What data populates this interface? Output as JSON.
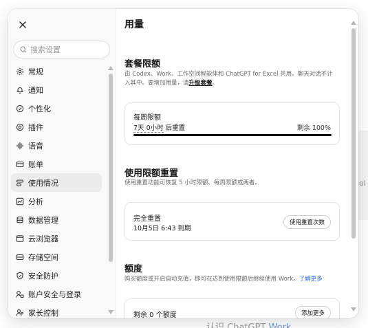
{
  "background": {
    "right_text": "ol",
    "bottom_text_prefix": "认识 ChatGPT",
    "bottom_text_accent": "Work"
  },
  "colors": {
    "accent_link": "#2f6fe0",
    "progress_fill": "#111111",
    "active_nav_bg": "#ececec"
  },
  "sidebar": {
    "close_icon": "close-icon",
    "search": {
      "placeholder": "搜索设置",
      "value": ""
    },
    "items": [
      {
        "label": "常规",
        "icon": "gear-icon"
      },
      {
        "label": "通知",
        "icon": "bell-icon"
      },
      {
        "label": "个性化",
        "icon": "personalize-icon"
      },
      {
        "label": "插件",
        "icon": "at-plugin-icon"
      },
      {
        "label": "语音",
        "icon": "voice-icon"
      },
      {
        "label": "账单",
        "icon": "card-icon"
      },
      {
        "label": "使用情况",
        "icon": "usage-icon",
        "active": true
      },
      {
        "label": "分析",
        "icon": "chart-icon"
      },
      {
        "label": "数据管理",
        "icon": "database-icon"
      },
      {
        "label": "云浏览器",
        "icon": "cloud-browser-icon"
      },
      {
        "label": "存储空间",
        "icon": "storage-icon"
      },
      {
        "label": "安全防护",
        "icon": "shield-icon"
      },
      {
        "label": "账户安全与登录",
        "icon": "account-lock-icon"
      },
      {
        "label": "家长控制",
        "icon": "parental-icon"
      }
    ]
  },
  "main": {
    "title": "用量",
    "plan_limits": {
      "title": "套餐限额",
      "desc_text": "由 Codex、Work、工作空间智能体和 ChatGPT for Excel 共用。聊天对话不计入其中。要增加用量，请",
      "desc_link": "升级套餐",
      "desc_end": "。",
      "card": {
        "title": "每周限额",
        "reset_time": "7天 0小时",
        "reset_suffix": " 后重置",
        "remaining": "剩余 100%",
        "progress_fraction": 1.0
      }
    },
    "limit_reset": {
      "title": "使用限额重置",
      "desc": "使用重置功能可恢复 5 小时限额、每周限额或两者。",
      "card": {
        "title": "完全重置",
        "expiry": "10月5日 6:43 到期",
        "button": "使用重置次数"
      }
    },
    "credits": {
      "title": "额度",
      "desc_text": "购买额度或开启自动充值，即可在达到使用限额后继续使用 Work。",
      "desc_link": "了解更多",
      "card": {
        "title": "剩余 0 个额度",
        "button": "添加更多"
      }
    }
  }
}
